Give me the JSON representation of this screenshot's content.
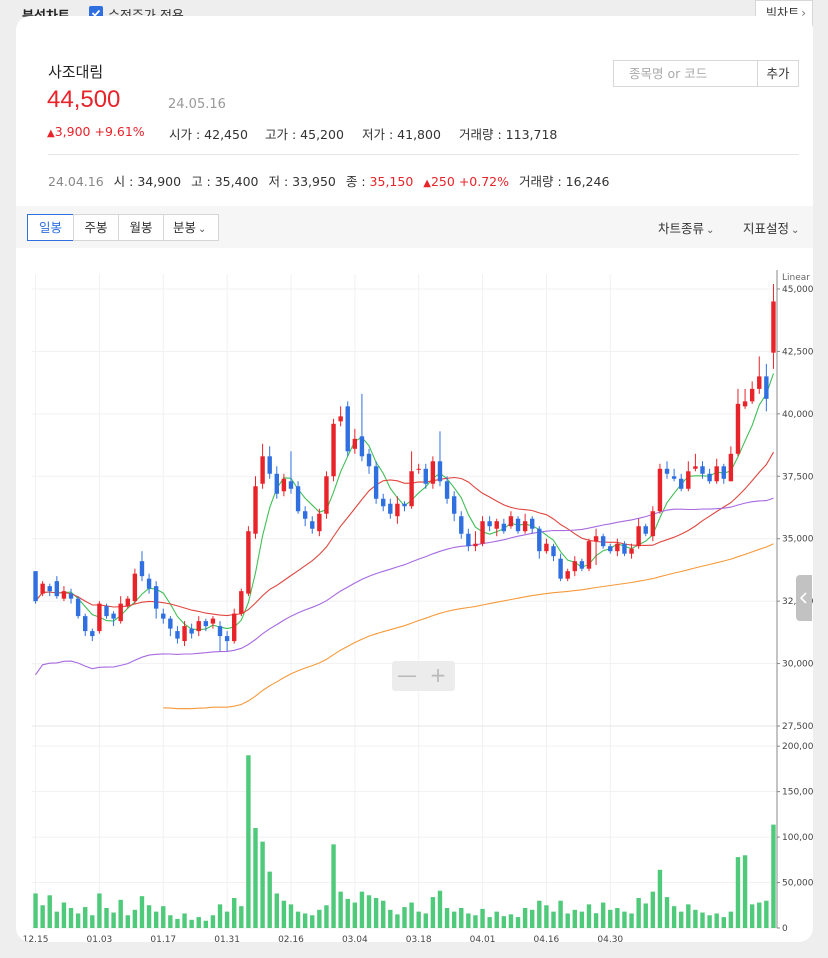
{
  "topbar": {
    "title": "분석차트",
    "adjusted_label": "수정주가 적용",
    "big_chart": "빅차트"
  },
  "stock": {
    "name": "사조대림",
    "price": "44,500",
    "date": "24.05.16",
    "change": "3,900",
    "change_pct": "+9.61%",
    "open_label": "시가 : ",
    "open": "42,450",
    "high_label": "고가 : ",
    "high": "45,200",
    "low_label": "저가 : ",
    "low": "41,800",
    "vol_label": "거래량 : ",
    "vol": "113,718"
  },
  "search": {
    "placeholder": "종목명 or 코드",
    "add": "추가"
  },
  "hover": {
    "date": "24.04.16",
    "o_label": "시 : ",
    "o": "34,900",
    "h_label": "고 : ",
    "h": "35,400",
    "l_label": "저 : ",
    "l": "33,950",
    "c_label": "종 : ",
    "c": "35,150",
    "chg": "250",
    "pct": "+0.72%",
    "v_label": "거래량 : ",
    "v": "16,246"
  },
  "tabs": [
    "일봉",
    "주봉",
    "월봉",
    "분봉"
  ],
  "menus": {
    "chart_type": "차트종류",
    "indicator": "지표설정"
  },
  "chart_data": {
    "type": "candlestick",
    "scale_label": "Linear",
    "x_ticks": [
      "12.15",
      "01.03",
      "01.17",
      "01.31",
      "02.16",
      "03.04",
      "03.18",
      "04.01",
      "04.16",
      "04.30"
    ],
    "y_ticks": [
      "45,000",
      "42,500",
      "40,000",
      "37,500",
      "35,000",
      "32,500",
      "30,000",
      "27,500"
    ],
    "y_range": [
      27500,
      45600
    ],
    "vol_ticks": [
      "200,000",
      "150,000",
      "100,000",
      "50,000",
      "0"
    ],
    "vol_range": [
      0,
      220000
    ],
    "tick_index": [
      0,
      9,
      18,
      27,
      36,
      45,
      54,
      63,
      72,
      81
    ],
    "colors": {
      "up": "#e8232a",
      "down": "#2f6fe0",
      "volume": "#4fc97a",
      "ma5": "#3fbf55",
      "ma20": "#e0463f",
      "ma60": "#a86ae0",
      "ma120": "#f59a3a"
    },
    "ohlc": [
      [
        33700,
        32500,
        33700,
        32400
      ],
      [
        32800,
        33200,
        33300,
        32700
      ],
      [
        33100,
        32900,
        33200,
        32700
      ],
      [
        33300,
        32700,
        33500,
        32600
      ],
      [
        32600,
        32900,
        33100,
        32500
      ],
      [
        32800,
        32600,
        33000,
        32400
      ],
      [
        32600,
        31900,
        32700,
        31800
      ],
      [
        31900,
        31300,
        32000,
        31100
      ],
      [
        31300,
        31100,
        31400,
        30900
      ],
      [
        31300,
        32400,
        32500,
        31200
      ],
      [
        32300,
        31900,
        32400,
        31800
      ],
      [
        32000,
        31800,
        32100,
        31500
      ],
      [
        31700,
        32400,
        32700,
        31600
      ],
      [
        32300,
        32600,
        32700,
        32200
      ],
      [
        32500,
        33600,
        33800,
        32400
      ],
      [
        34100,
        33500,
        34500,
        33300
      ],
      [
        33400,
        33000,
        33600,
        32800
      ],
      [
        33100,
        32200,
        33300,
        31800
      ],
      [
        32000,
        31800,
        32200,
        31600
      ],
      [
        31800,
        31400,
        31900,
        31100
      ],
      [
        31300,
        31000,
        31500,
        30800
      ],
      [
        30900,
        31500,
        31700,
        30700
      ],
      [
        31400,
        31200,
        31600,
        31000
      ],
      [
        31300,
        31700,
        31900,
        31100
      ],
      [
        31700,
        31500,
        31800,
        31300
      ],
      [
        31600,
        31800,
        31900,
        31400
      ],
      [
        31500,
        31100,
        31700,
        30500
      ],
      [
        31100,
        30900,
        31300,
        30500
      ],
      [
        30900,
        32000,
        32200,
        30800
      ],
      [
        32000,
        32900,
        33000,
        31900
      ],
      [
        32800,
        35300,
        35500,
        32700
      ],
      [
        35200,
        37100,
        37500,
        35000
      ],
      [
        37200,
        38300,
        38800,
        37000
      ],
      [
        38300,
        37600,
        38700,
        37400
      ],
      [
        37600,
        36800,
        37900,
        36600
      ],
      [
        36900,
        37400,
        37600,
        36700
      ],
      [
        37300,
        37000,
        38500,
        36800
      ],
      [
        37100,
        36100,
        37300,
        36000
      ],
      [
        36100,
        35800,
        36300,
        35500
      ],
      [
        35700,
        35400,
        35900,
        35200
      ],
      [
        35300,
        36000,
        36200,
        35100
      ],
      [
        36000,
        37500,
        37700,
        35800
      ],
      [
        37500,
        39600,
        39800,
        37300
      ],
      [
        39700,
        39900,
        40300,
        39500
      ],
      [
        40300,
        38500,
        40500,
        38300
      ],
      [
        38600,
        39000,
        39400,
        38400
      ],
      [
        39100,
        38300,
        40800,
        38100
      ],
      [
        38400,
        37900,
        38600,
        37600
      ],
      [
        37900,
        36600,
        38100,
        36400
      ],
      [
        36600,
        36300,
        36800,
        36100
      ],
      [
        36400,
        36000,
        36600,
        35800
      ],
      [
        35900,
        36400,
        36700,
        35600
      ],
      [
        36400,
        36300,
        36500,
        36100
      ],
      [
        36300,
        37700,
        38500,
        36200
      ],
      [
        37800,
        37800,
        38000,
        37600
      ],
      [
        37800,
        37200,
        38000,
        37000
      ],
      [
        37200,
        38100,
        38300,
        37000
      ],
      [
        38100,
        37300,
        39300,
        37100
      ],
      [
        37300,
        36600,
        37500,
        36400
      ],
      [
        36700,
        36000,
        36900,
        35700
      ],
      [
        35900,
        35200,
        36100,
        35000
      ],
      [
        35200,
        34700,
        35400,
        34500
      ],
      [
        34700,
        34800,
        35300,
        34500
      ],
      [
        34800,
        35700,
        35900,
        34700
      ],
      [
        35700,
        35500,
        35900,
        35300
      ],
      [
        35400,
        35700,
        35800,
        35100
      ],
      [
        35600,
        35300,
        35800,
        35200
      ],
      [
        35500,
        35900,
        36100,
        35400
      ],
      [
        35800,
        35300,
        35900,
        35200
      ],
      [
        35300,
        35700,
        36000,
        35200
      ],
      [
        35800,
        35400,
        35900,
        35200
      ],
      [
        35400,
        34500,
        35500,
        34200
      ],
      [
        34500,
        34800,
        35000,
        34400
      ],
      [
        34700,
        34300,
        34800,
        34100
      ],
      [
        34200,
        33400,
        34400,
        33300
      ],
      [
        33400,
        33700,
        33800,
        33300
      ],
      [
        33700,
        34100,
        34300,
        33500
      ],
      [
        34100,
        33800,
        34200,
        33700
      ],
      [
        33800,
        34900,
        35000,
        33700
      ],
      [
        34900,
        35100,
        35400,
        33950
      ],
      [
        35100,
        34700,
        35200,
        34600
      ],
      [
        34700,
        34500,
        34800,
        34400
      ],
      [
        34500,
        34800,
        35000,
        34300
      ],
      [
        34800,
        34400,
        34900,
        34300
      ],
      [
        34400,
        34600,
        34800,
        34200
      ],
      [
        34700,
        35500,
        35800,
        34600
      ],
      [
        35500,
        35200,
        35600,
        35100
      ],
      [
        35100,
        36100,
        36300,
        34900
      ],
      [
        36100,
        37800,
        38000,
        36000
      ],
      [
        37800,
        37600,
        38100,
        37400
      ],
      [
        37500,
        37400,
        37800,
        37300
      ],
      [
        37400,
        37000,
        37600,
        36900
      ],
      [
        37000,
        37700,
        38100,
        36900
      ],
      [
        37800,
        37900,
        38400,
        37700
      ],
      [
        37900,
        37600,
        38100,
        37400
      ],
      [
        37600,
        37300,
        37800,
        37200
      ],
      [
        37300,
        37900,
        38200,
        37200
      ],
      [
        37900,
        37400,
        38000,
        37200
      ],
      [
        37300,
        38400,
        38700,
        37300
      ],
      [
        38400,
        40400,
        41000,
        38300
      ],
      [
        40300,
        40500,
        41000,
        40200
      ],
      [
        40500,
        41000,
        41300,
        40400
      ],
      [
        41000,
        41500,
        42300,
        40800
      ],
      [
        41500,
        40600,
        42000,
        40100
      ],
      [
        42450,
        44500,
        45200,
        41800
      ]
    ],
    "volume": [
      38000,
      25000,
      36000,
      18000,
      28000,
      22000,
      16000,
      23000,
      14000,
      38000,
      22000,
      17000,
      31000,
      14000,
      20000,
      35000,
      25000,
      18000,
      24000,
      14000,
      10000,
      16000,
      9000,
      12000,
      8000,
      14000,
      26000,
      18000,
      33000,
      24000,
      190000,
      110000,
      95000,
      62000,
      38000,
      30000,
      26000,
      18000,
      16000,
      14000,
      20000,
      25000,
      92000,
      40000,
      32000,
      28000,
      40000,
      36000,
      33000,
      30000,
      20000,
      15000,
      23000,
      28000,
      18000,
      16000,
      34000,
      41000,
      22000,
      18000,
      22000,
      16000,
      14000,
      21000,
      12000,
      18000,
      13000,
      15000,
      12000,
      22000,
      20000,
      30000,
      25000,
      18000,
      30000,
      16000,
      20000,
      18000,
      26000,
      16246,
      28000,
      20000,
      22000,
      18000,
      16000,
      33000,
      27000,
      40000,
      64000,
      34000,
      24000,
      18000,
      26000,
      20000,
      17000,
      14000,
      16000,
      12000,
      18000,
      78000,
      80000,
      26000,
      28000,
      30000,
      113718
    ]
  }
}
